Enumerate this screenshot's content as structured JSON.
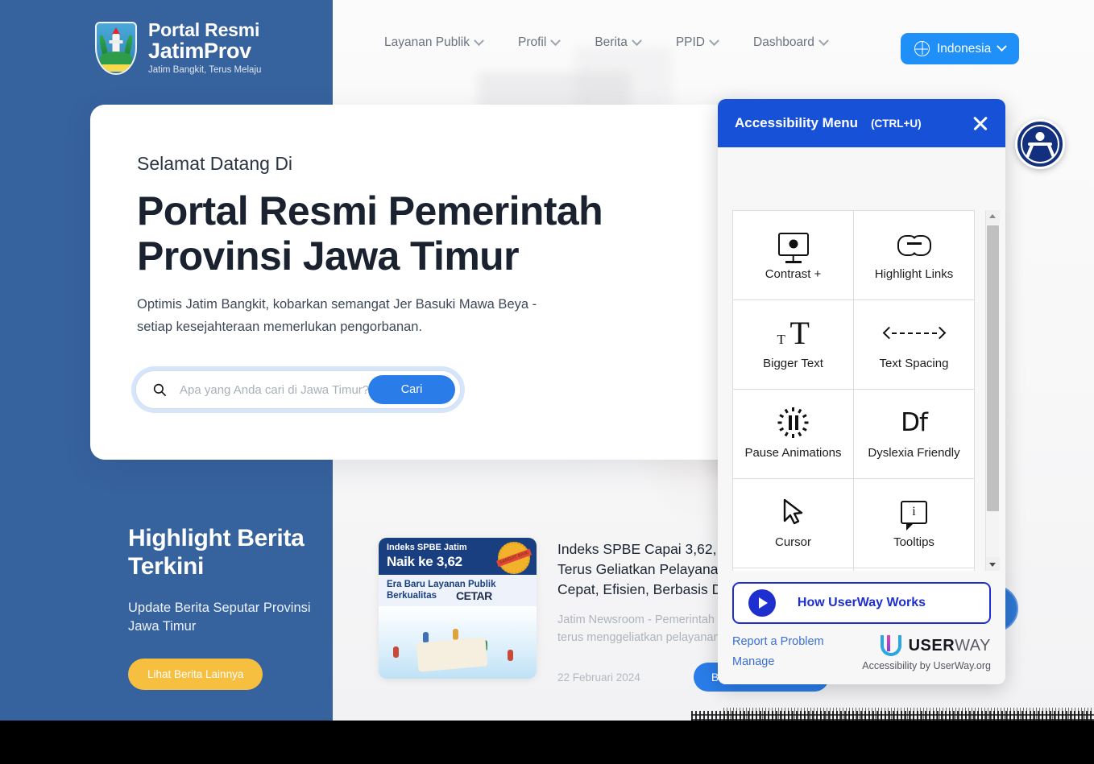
{
  "header": {
    "brand": {
      "line1": "Portal Resmi",
      "line2": "JatimProv",
      "tagline": "Jatim Bangkit, Terus Melaju"
    },
    "nav": [
      {
        "label": "Layanan Publik"
      },
      {
        "label": "Profil"
      },
      {
        "label": "Berita"
      },
      {
        "label": "PPID"
      },
      {
        "label": "Dashboard"
      }
    ],
    "language": {
      "label": "Indonesia",
      "icon": "globe-icon"
    }
  },
  "hero": {
    "kicker": "Selamat Datang Di",
    "title": "Portal Resmi Pemerintah Provinsi Jawa Timur",
    "description": "Optimis Jatim Bangkit, kobarkan semangat Jer Basuki Mawa Beya - setiap kesejahteraan memerlukan pengorbanan.",
    "search": {
      "placeholder": "Apa yang Anda cari di Jawa Timur?",
      "value": "",
      "button": "Cari",
      "icon": "search-icon"
    }
  },
  "highlight": {
    "title": "Highlight Berita Terkini",
    "subtitle": "Update Berita Seputar Provinsi Jawa Timur",
    "button": "Lihat Berita Lainnya"
  },
  "news": {
    "thumb": {
      "badge_line1": "Indeks SPBE Jatim",
      "badge_line2": "Naik ke 3,62",
      "seal": "SANGAT BAIK",
      "caption_line1": "Era Baru Layanan Publik",
      "caption_line2": "Berkualitas",
      "caption_mark": "CETAR"
    },
    "title": "Indeks SPBE Capai 3,62, Pemprov Jatim Terus Geliatkan Pelayanan Publik yang Cepat, Efisien, Berbasis Digital",
    "excerpt": "Jatim Newsroom - Pemerintah Provinsi Jawa Timur terus menggeliatkan pelayanan publik yang cepat..",
    "date": "22 Februari 2024",
    "button": "Baca Selengkapnya"
  },
  "a11y_fab": {
    "name": "accessibility-widget-button"
  },
  "panel": {
    "title": "Accessibility Menu",
    "shortcut": "(CTRL+U)",
    "close_icon": "close-icon",
    "options": [
      {
        "label": "Contrast +",
        "icon": "monitor-contrast-icon"
      },
      {
        "label": "Highlight Links",
        "icon": "link-icon"
      },
      {
        "label": "Bigger Text",
        "icon": "bigger-text-icon"
      },
      {
        "label": "Text Spacing",
        "icon": "text-spacing-icon"
      },
      {
        "label": "Pause Animations",
        "icon": "pause-animations-icon"
      },
      {
        "label": "Dyslexia Friendly",
        "icon": "dyslexia-df-icon"
      },
      {
        "label": "Cursor",
        "icon": "cursor-icon"
      },
      {
        "label": "Tooltips",
        "icon": "tooltip-icon"
      }
    ],
    "footer": {
      "how_button": "How UserWay Works",
      "report_link": "Report a Problem",
      "manage_link": "Manage",
      "brand_bold": "USER",
      "brand_light": "WAY",
      "brand_sub": "Accessibility by UserWay.org"
    }
  },
  "colors": {
    "sidebar_blue": "#36629e",
    "accent_blue": "#2a7de9",
    "lang_blue": "#1e90f7",
    "panel_header_blue": "#1751d8",
    "userway_indigo": "#1e2fd0",
    "highlight_yellow": "#f6bf3f",
    "fab_navy": "#12307e"
  }
}
